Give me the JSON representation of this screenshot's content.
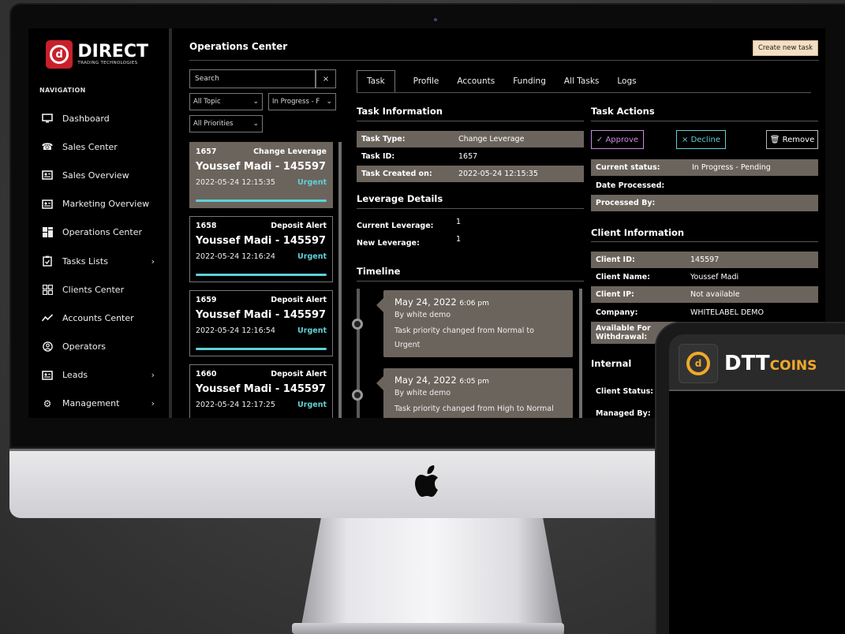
{
  "brand": {
    "logo_title": "DIRECT",
    "logo_subtitle": "TRADING TECHNOLOGIES",
    "phone_logo_main": "DTT",
    "phone_logo_accent": "COINS"
  },
  "nav": {
    "heading": "NAVIGATION",
    "items": [
      {
        "label": "Dashboard",
        "icon": "monitor-icon",
        "has_children": false
      },
      {
        "label": "Sales Center",
        "icon": "phone-icon",
        "has_children": false
      },
      {
        "label": "Sales Overview",
        "icon": "id-card-icon",
        "has_children": false
      },
      {
        "label": "Marketing Overview",
        "icon": "id-card-icon",
        "has_children": false
      },
      {
        "label": "Operations Center",
        "icon": "grid-icon",
        "has_children": false
      },
      {
        "label": "Tasks Lists",
        "icon": "clipboard-check-icon",
        "has_children": true
      },
      {
        "label": "Clients Center",
        "icon": "dashboard-icon",
        "has_children": false
      },
      {
        "label": "Accounts Center",
        "icon": "trend-icon",
        "has_children": false
      },
      {
        "label": "Operators",
        "icon": "user-circle-icon",
        "has_children": false
      },
      {
        "label": "Leads",
        "icon": "id-card-icon",
        "has_children": true
      },
      {
        "label": "Management",
        "icon": "gear-icon",
        "has_children": true
      }
    ]
  },
  "header": {
    "title": "Operations Center",
    "create_button": "Create new task"
  },
  "filters": {
    "search_placeholder": "Search",
    "clear": "×",
    "topic": "All Topic",
    "status": "In Progress - F",
    "priority": "All Priorities"
  },
  "tasks": [
    {
      "id": "1657",
      "type": "Change Leverage",
      "name": "Youssef Madi - 145597",
      "date": "2022-05-24 12:15:35",
      "priority": "Urgent"
    },
    {
      "id": "1658",
      "type": "Deposit Alert",
      "name": "Youssef Madi - 145597",
      "date": "2022-05-24 12:16:24",
      "priority": "Urgent"
    },
    {
      "id": "1659",
      "type": "Deposit Alert",
      "name": "Youssef Madi - 145597",
      "date": "2022-05-24 12:16:54",
      "priority": "Urgent"
    },
    {
      "id": "1660",
      "type": "Deposit Alert",
      "name": "Youssef Madi - 145597",
      "date": "2022-05-24 12:17:25",
      "priority": "Urgent"
    }
  ],
  "tabs": [
    "Task",
    "Profile",
    "Accounts",
    "Funding",
    "All Tasks",
    "Logs"
  ],
  "task_info": {
    "title": "Task Information",
    "rows": [
      {
        "label": "Task Type:",
        "value": "Change Leverage"
      },
      {
        "label": "Task ID:",
        "value": "1657"
      },
      {
        "label": "Task Created on:",
        "value": "2022-05-24 12:15:35"
      }
    ]
  },
  "leverage": {
    "title": "Leverage Details",
    "rows": [
      {
        "label": "Current Leverage:",
        "value": "1"
      },
      {
        "label": "New Leverage:",
        "value": "1"
      }
    ]
  },
  "timeline": {
    "title": "Timeline",
    "events": [
      {
        "date": "May 24, 2022",
        "time": "6:06 pm",
        "by": "By white demo",
        "msg1": "Task priority changed from Normal to",
        "msg2": "Urgent"
      },
      {
        "date": "May 24, 2022",
        "time": "6:05 pm",
        "by": "By white demo",
        "msg1": "Task priority changed from High to Normal",
        "msg2": ""
      }
    ]
  },
  "task_actions": {
    "title": "Task Actions",
    "approve": "✓ Approve",
    "decline": "× Decline",
    "remove": "🗑 Remove",
    "rows": [
      {
        "label": "Current status:",
        "value": "In Progress - Pending"
      },
      {
        "label": "Date Processed:",
        "value": ""
      },
      {
        "label": "Processed By:",
        "value": ""
      }
    ]
  },
  "client_info": {
    "title": "Client Information",
    "rows": [
      {
        "label": "Client ID:",
        "value": "145597"
      },
      {
        "label": "Client Name:",
        "value": "Youssef Madi"
      },
      {
        "label": "Client IP:",
        "value": "Not available"
      },
      {
        "label": "Company:",
        "value": "WHITELABEL DEMO"
      }
    ],
    "withdrawal_label_1": "Available For",
    "withdrawal_label_2": "Withdrawal:"
  },
  "internal": {
    "title": "Internal",
    "client_status": "Client Status:",
    "managed_by": "Managed By:"
  },
  "colors": {
    "accent_cyan": "#5fd1d6",
    "approve": "#c98be0",
    "decline": "#5fd1d6",
    "brand_red": "#c8202b",
    "coins_gold": "#f0a82a",
    "row_shade": "#6b645d"
  }
}
